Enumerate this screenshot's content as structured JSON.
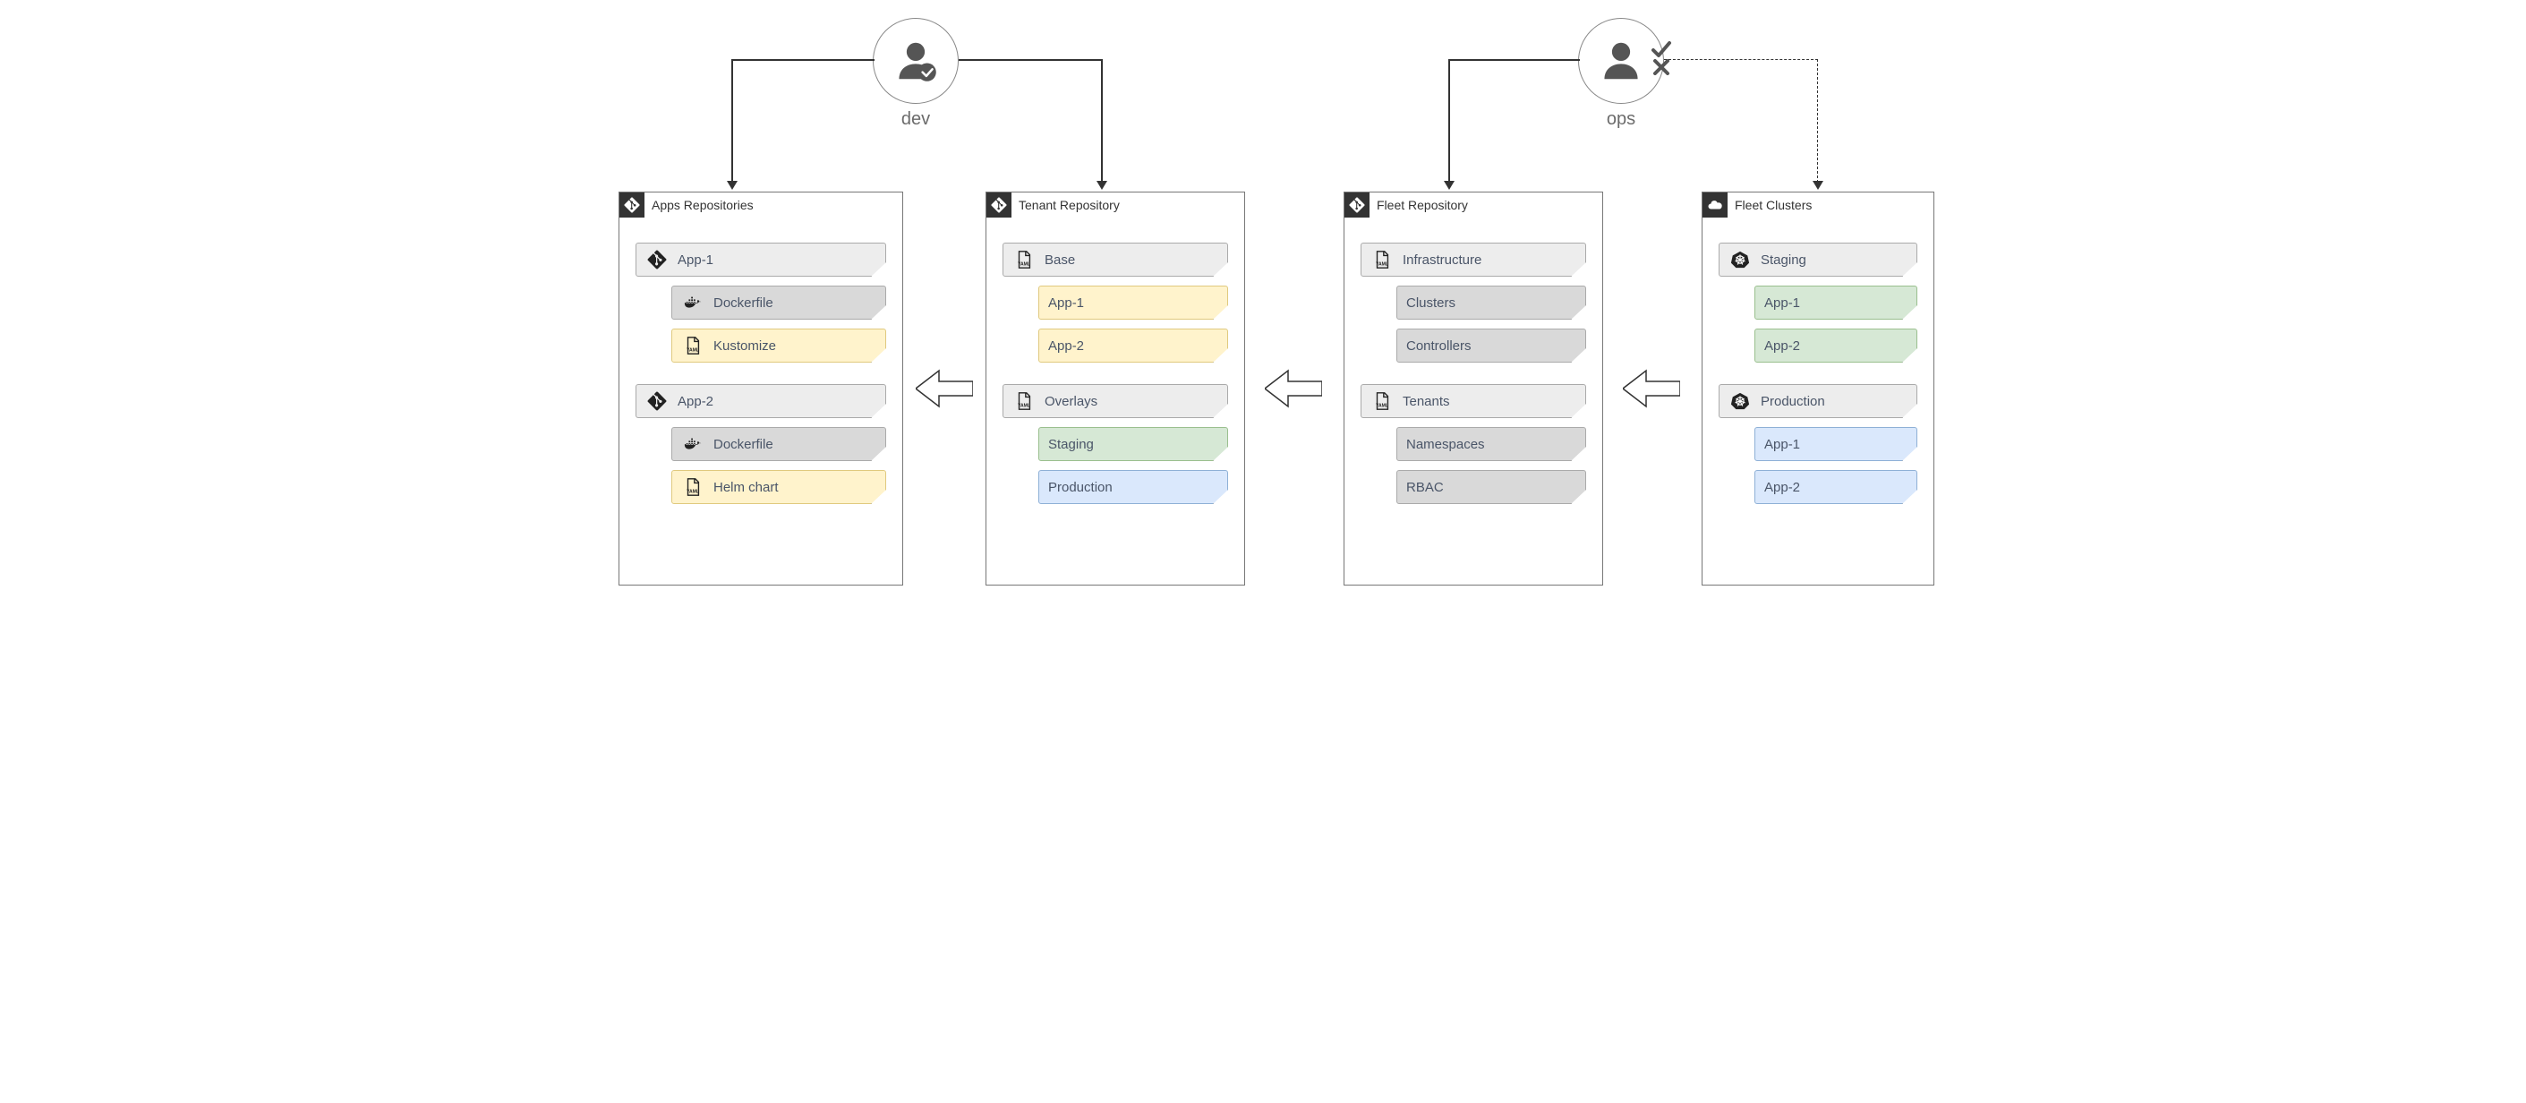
{
  "actors": {
    "dev": "dev",
    "ops": "ops"
  },
  "panels": {
    "apps": {
      "title": "Apps Repositories",
      "groups": [
        {
          "head": "App-1",
          "items": [
            {
              "label": "Dockerfile",
              "kind": "docker",
              "color": "darkgray"
            },
            {
              "label": "Kustomize",
              "kind": "yaml",
              "color": "yellow"
            }
          ]
        },
        {
          "head": "App-2",
          "items": [
            {
              "label": "Dockerfile",
              "kind": "docker",
              "color": "darkgray"
            },
            {
              "label": "Helm chart",
              "kind": "yaml",
              "color": "yellow"
            }
          ]
        }
      ]
    },
    "tenant": {
      "title": "Tenant Repository",
      "groups": [
        {
          "head": "Base",
          "items": [
            {
              "label": "App-1",
              "color": "yellow"
            },
            {
              "label": "App-2",
              "color": "yellow"
            }
          ]
        },
        {
          "head": "Overlays",
          "items": [
            {
              "label": "Staging",
              "color": "green"
            },
            {
              "label": "Production",
              "color": "blue"
            }
          ]
        }
      ]
    },
    "fleet_repo": {
      "title": "Fleet Repository",
      "groups": [
        {
          "head": "Infrastructure",
          "items": [
            {
              "label": "Clusters",
              "color": "darkgray"
            },
            {
              "label": "Controllers",
              "color": "darkgray"
            }
          ]
        },
        {
          "head": "Tenants",
          "items": [
            {
              "label": "Namespaces",
              "color": "darkgray"
            },
            {
              "label": "RBAC",
              "color": "darkgray"
            }
          ]
        }
      ]
    },
    "fleet_clusters": {
      "title": "Fleet Clusters",
      "groups": [
        {
          "head": "Staging",
          "items": [
            {
              "label": "App-1",
              "color": "green"
            },
            {
              "label": "App-2",
              "color": "green"
            }
          ]
        },
        {
          "head": "Production",
          "items": [
            {
              "label": "App-1",
              "color": "blue"
            },
            {
              "label": "App-2",
              "color": "blue"
            }
          ]
        }
      ]
    }
  }
}
